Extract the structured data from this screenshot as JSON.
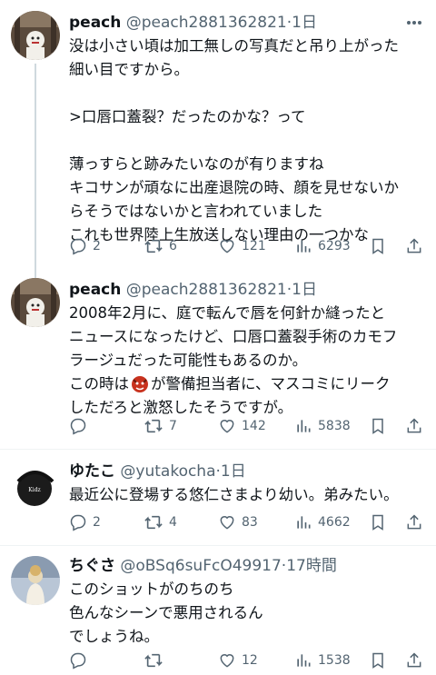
{
  "tweets": [
    {
      "name": "peach",
      "handle": "@peach2881362821",
      "dot": "·",
      "time": "1日",
      "lines": [
        "没は小さい頃は加工無しの写真だと吊り上がった",
        "細い目ですから。",
        "",
        ">口唇口蓋裂？だったのかな？って",
        "",
        "薄っすらと跡みたいなのが有りますね",
        "キコサンが頑なに出産退院の時、顔を見せないか",
        "らそうではないかと言われていました",
        "これも世界陸上生放送しない理由の一つかな"
      ],
      "stats": {
        "reply": "2",
        "retweet": "6",
        "like": "121",
        "views": "6293"
      }
    },
    {
      "name": "peach",
      "handle": "@peach2881362821",
      "dot": "·",
      "time": "1日",
      "lines": [
        "2008年2月に、庭で転んで唇を何針か縫ったと",
        "ニュースになったけど、口唇口蓋裂手術のカモフ",
        "ラージュだった可能性もあるのか。"
      ],
      "line4_pre": "この時は",
      "line4_post": "が警備担当者に、マスコミにリーク",
      "lines2": [
        "しただろと激怒したそうですが。"
      ],
      "stats": {
        "reply": "",
        "retweet": "7",
        "like": "142",
        "views": "5838"
      }
    },
    {
      "name": "ゆたこ",
      "handle": "@yutakocha",
      "dot": "·",
      "time": "1日",
      "lines": [
        "最近公に登場する悠仁さまより幼い。弟みたい。"
      ],
      "stats": {
        "reply": "2",
        "retweet": "4",
        "like": "83",
        "views": "4662"
      }
    },
    {
      "name": "ちぐさ",
      "handle": "@oBSq6suFcO49917",
      "dot": "·",
      "time": "17時間",
      "lines": [
        "このショットがのちのち",
        "色んなシーンで悪用されるん",
        "でしょうね。"
      ],
      "stats": {
        "reply": "",
        "retweet": "",
        "like": "12",
        "views": "1538"
      }
    }
  ],
  "colors": {
    "text": "#0f1419",
    "muted": "#536471",
    "separator": "#eff3f4",
    "thread": "#cfd9de"
  }
}
